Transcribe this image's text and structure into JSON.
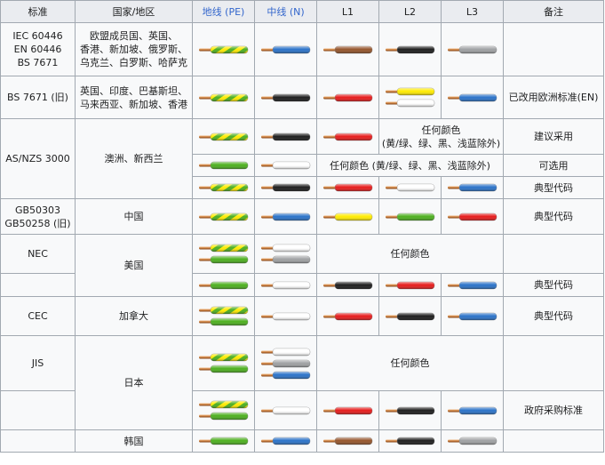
{
  "colors": {
    "green": "#4caf1e",
    "yellow": "#ffeb00",
    "brown": "#94542a",
    "black": "#1c1c1c",
    "gray": "#9ea0a2",
    "blue": "#2a72c8",
    "red": "#e61b1b",
    "white": "#ffffff"
  },
  "header": {
    "standard": "标准",
    "country": "国家/地区",
    "pe": "地线 (PE)",
    "neutral": "中线 (N)",
    "l1": "L1",
    "l2": "L2",
    "l3": "L3",
    "remarks": "备注"
  },
  "standards": {
    "iec": "IEC 60446\nEN 60446\nBS 7671",
    "bs_old": "BS 7671 (旧)",
    "asnzs": "AS/NZS 3000",
    "gb": "GB50303\nGB50258 (旧)",
    "nec": "NEC",
    "cec": "CEC",
    "jis": "JIS"
  },
  "countries": {
    "iec": "欧盟成员国、英国、\n香港、新加坡、俄罗斯、\n乌克兰、白罗斯、哈萨克",
    "bs_old": "英国、印度、巴基斯坦、\n马来西亚、新加坡、香港",
    "au": "澳洲、新西兰",
    "cn": "中国",
    "us": "美国",
    "ca": "加拿大",
    "jp": "日本",
    "kr": "韩国"
  },
  "notes": {
    "any_color": "任何颜色",
    "any_color_except": "任何颜色\n(黄/绿、绿、黑、浅蓝除外)",
    "any_color_except_inline": "任何颜色 (黄/绿、绿、黑、浅蓝除外)"
  },
  "remarks": {
    "bs_old": "已改用欧洲标准(EN)",
    "recommended": "建议采用",
    "optional": "可选用",
    "typical": "典型代码",
    "gov": "政府采购标准"
  },
  "wires": {
    "iec": {
      "pe": [
        "yellow-green"
      ],
      "n": [
        "blue"
      ],
      "l1": [
        "brown"
      ],
      "l2": [
        "black"
      ],
      "l3": [
        "gray"
      ]
    },
    "bs_old": {
      "pe": [
        "yellow-green"
      ],
      "n": [
        "black"
      ],
      "l1": [
        "red"
      ],
      "l2": [
        "yellow",
        "white"
      ],
      "l3": [
        "blue"
      ]
    },
    "au1": {
      "pe": [
        "yellow-green"
      ],
      "n": [
        "black"
      ],
      "l1": [
        "red"
      ]
    },
    "au2": {
      "pe": [
        "green"
      ],
      "n": [
        "white"
      ]
    },
    "au3": {
      "pe": [
        "yellow-green"
      ],
      "n": [
        "black"
      ],
      "l1": [
        "red"
      ],
      "l2": [
        "white"
      ],
      "l3": [
        "blue"
      ]
    },
    "cn": {
      "pe": [
        "yellow-green"
      ],
      "n": [
        "blue"
      ],
      "l1": [
        "yellow"
      ],
      "l2": [
        "green"
      ],
      "l3": [
        "red"
      ]
    },
    "nec1": {
      "pe": [
        "yellow-green",
        "green"
      ],
      "n": [
        "white",
        "gray"
      ]
    },
    "nec2": {
      "pe": [
        "green"
      ],
      "n": [
        "white"
      ],
      "l1": [
        "black"
      ],
      "l2": [
        "red"
      ],
      "l3": [
        "blue"
      ]
    },
    "cec": {
      "pe": [
        "yellow-green",
        "green"
      ],
      "n": [
        "white"
      ],
      "l1": [
        "red"
      ],
      "l2": [
        "black"
      ],
      "l3": [
        "blue"
      ]
    },
    "jis1": {
      "pe": [
        "yellow-green",
        "green"
      ],
      "n": [
        "white",
        "gray",
        "blue"
      ]
    },
    "jis2": {
      "pe": [
        "yellow-green",
        "green"
      ],
      "n": [
        "white"
      ],
      "l1": [
        "red"
      ],
      "l2": [
        "black"
      ],
      "l3": [
        "blue"
      ]
    },
    "kr": {
      "pe": [
        "green"
      ],
      "n": [
        "blue"
      ],
      "l1": [
        "brown"
      ],
      "l2": [
        "black"
      ],
      "l3": [
        "gray"
      ]
    }
  }
}
